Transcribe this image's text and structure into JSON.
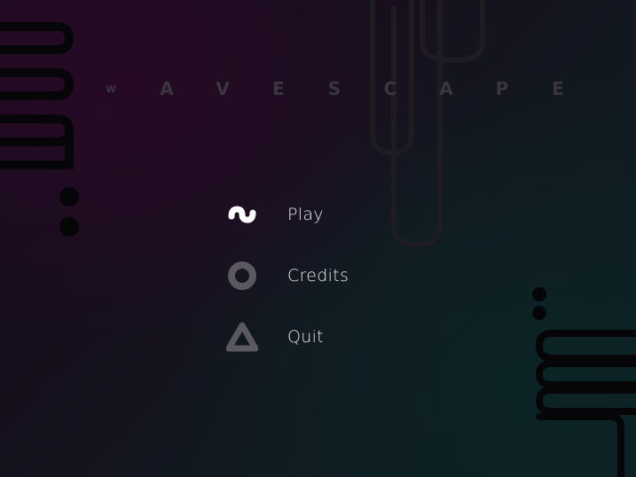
{
  "title": {
    "letters": [
      "w",
      "A",
      "V",
      "E",
      "S",
      "C",
      "A",
      "P",
      "E"
    ]
  },
  "menu": {
    "items": [
      {
        "label": "Play",
        "icon": "wave-icon"
      },
      {
        "label": "Credits",
        "icon": "circle-icon"
      },
      {
        "label": "Quit",
        "icon": "triangle-icon"
      }
    ]
  },
  "colors": {
    "background": "#160f1d",
    "title_text": "#3a3540",
    "menu_text": "#e9e6ec",
    "icon_active": "#ffffff",
    "icon_inactive": "#5a5860",
    "decor": "#050507"
  }
}
